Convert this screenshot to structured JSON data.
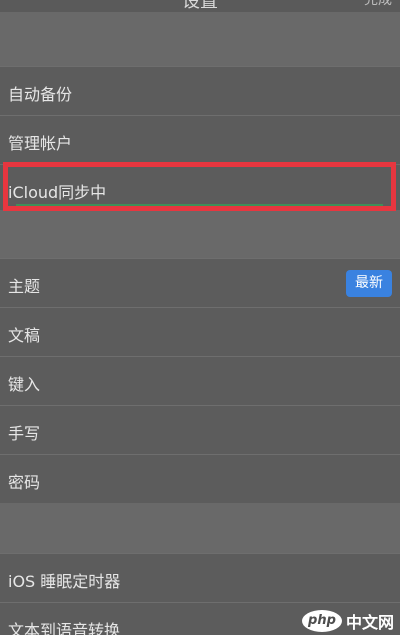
{
  "header": {
    "title": "设置",
    "right_label": "完成"
  },
  "settings": {
    "auto_backup": "自动备份",
    "manage_account": "管理帐户",
    "icloud_sync": "iCloud同步中",
    "theme": "主题",
    "theme_badge": "最新",
    "document": "文稿",
    "typing": "键入",
    "handwriting": "手写",
    "password": "密码",
    "ios_sleep_timer": "iOS 睡眠定时器",
    "text_to_speech": "文本到语音转换"
  },
  "highlight": {
    "color": "#e8363f"
  },
  "watermark": {
    "logo": "php",
    "text": "中文网"
  }
}
